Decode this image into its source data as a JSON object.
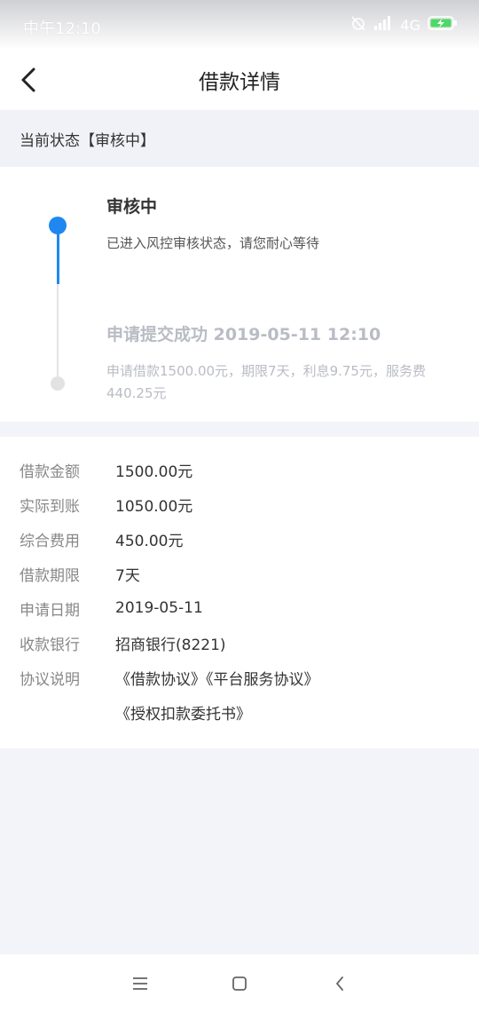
{
  "status_bar": {
    "time": "中午12:10",
    "network": "4G"
  },
  "header": {
    "title": "借款详情",
    "back_icon": "chevron-left-icon"
  },
  "current_status": {
    "text": "当前状态【审核中】"
  },
  "timeline": {
    "steps": [
      {
        "title": "审核中",
        "description": "已进入风控审核状态，请您耐心等待",
        "active": true
      },
      {
        "title": "申请提交成功 2019-05-11 12:10",
        "description": "申请借款1500.00元，期限7天，利息9.75元，服务费440.25元",
        "active": false
      }
    ]
  },
  "details": {
    "rows": [
      {
        "label": "借款金额",
        "value": "1500.00元"
      },
      {
        "label": "实际到账",
        "value": "1050.00元"
      },
      {
        "label": "综合费用",
        "value": "450.00元"
      },
      {
        "label": "借款期限",
        "value": "7天"
      },
      {
        "label": "申请日期",
        "value": "2019-05-11"
      },
      {
        "label": "收款银行",
        "value": "招商银行(8221)"
      }
    ],
    "agreement": {
      "label": "协议说明",
      "links": [
        "《借款协议》《平台服务协议》",
        "《授权扣款委托书》"
      ]
    }
  },
  "colors": {
    "accent": "#1e88f0",
    "link": "#3367c4",
    "background": "#f3f4f9"
  }
}
